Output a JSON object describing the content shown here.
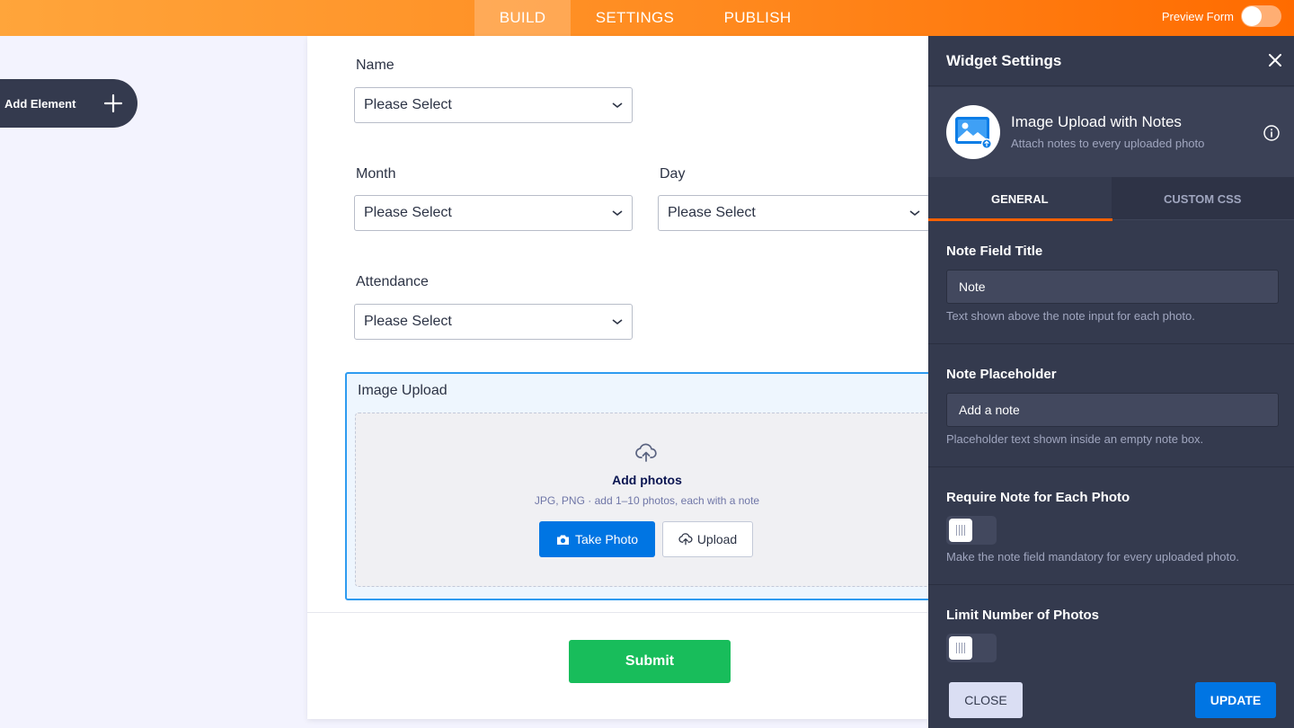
{
  "topbar": {
    "tabs": [
      {
        "label": "BUILD",
        "active": true
      },
      {
        "label": "SETTINGS",
        "active": false
      },
      {
        "label": "PUBLISH",
        "active": false
      }
    ],
    "preview_label": "Preview Form",
    "preview_on": false,
    "gradient": [
      "#ffa53b",
      "#ff6b00"
    ]
  },
  "add_element": {
    "label": "Add Element",
    "icon": "plus-icon"
  },
  "form": {
    "fields": [
      {
        "label": "Name",
        "value": "Please Select"
      },
      {
        "label": "Month",
        "value": "Please Select"
      },
      {
        "label": "Day",
        "value": "Please Select"
      },
      {
        "label": "Attendance",
        "value": "Please Select"
      }
    ],
    "upload": {
      "title": "Image Upload",
      "heading": "Add photos",
      "hint": "JPG, PNG · add 1–10 photos, each with a note",
      "take_photo": "Take Photo",
      "upload": "Upload"
    },
    "submit": "Submit",
    "submit_color": "#18bd5b"
  },
  "panel": {
    "title": "Widget Settings",
    "widget": {
      "name": "Image Upload with Notes",
      "description": "Attach notes to every uploaded photo",
      "icon": "image-upload-icon"
    },
    "tabs": [
      "GENERAL",
      "CUSTOM CSS"
    ],
    "active_tab": "GENERAL",
    "sections": {
      "note_title": {
        "heading": "Note Field Title",
        "value": "Note",
        "description": "Text shown above the note input for each photo."
      },
      "note_placeholder": {
        "heading": "Note Placeholder",
        "value": "Add a note",
        "description": "Placeholder text shown inside an empty note box."
      },
      "require_note": {
        "heading": "Require Note for Each Photo",
        "enabled": false,
        "description": "Make the note field mandatory for every uploaded photo."
      },
      "limit_photos": {
        "heading": "Limit Number of Photos",
        "enabled": false
      }
    },
    "close_button": "CLOSE",
    "update_button": "UPDATE",
    "accent": "#ff6100"
  }
}
